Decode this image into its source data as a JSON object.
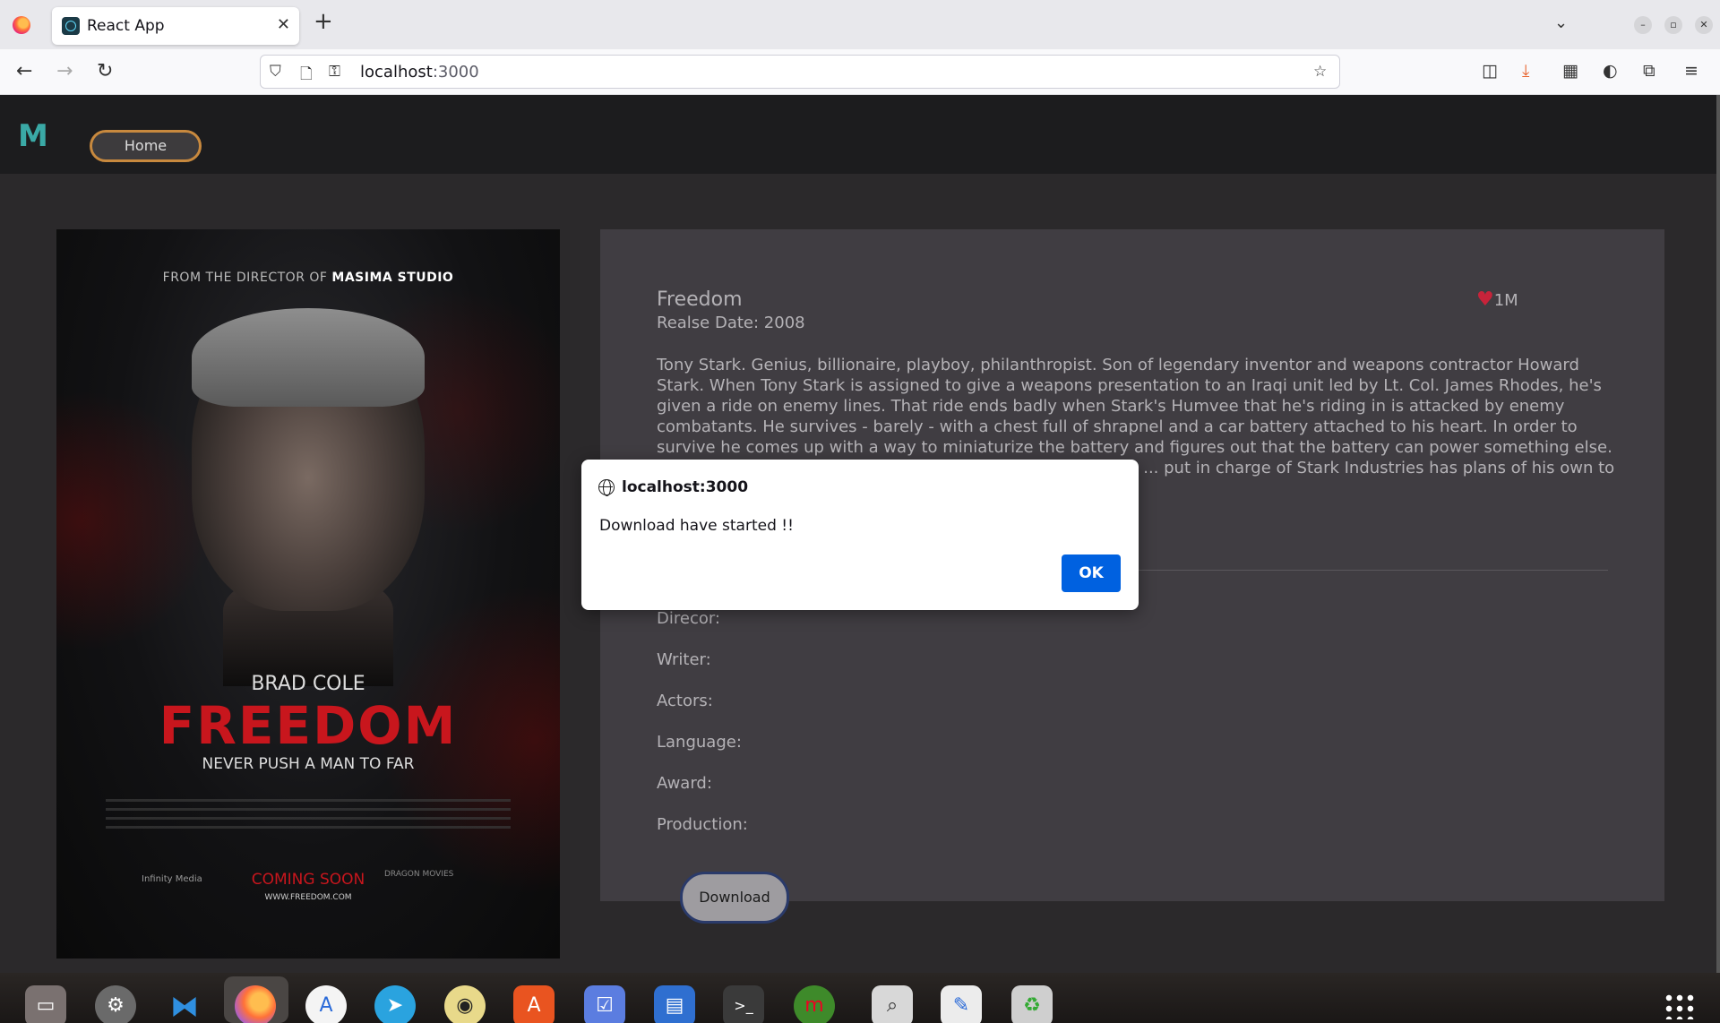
{
  "browser": {
    "tab_title": "React App",
    "tab_close": "✕",
    "new_tab": "+",
    "url_host": "localhost",
    "url_port": ":3000"
  },
  "site": {
    "logo": "M",
    "nav": {
      "home_label": "Home"
    }
  },
  "poster": {
    "from_prefix": "FROM THE DIRECTOR OF",
    "from_studio": "MASIMA STUDIO",
    "actor": "BRAD COLE",
    "title": "FREEDOM",
    "tagline": "NEVER PUSH A MAN TO FAR",
    "left_logo": "Infinity Media",
    "coming_soon": "COMING SOON",
    "url": "WWW.FREEDOM.COM",
    "right_logo": "DRAGON MOVIES"
  },
  "movie": {
    "title": "Freedom",
    "release": "Realse Date: 2008",
    "likes": "1M",
    "description": "Tony Stark. Genius, billionaire, playboy, philanthropist. Son of legendary inventor and weapons contractor Howard Stark. When Tony Stark is assigned to give a weapons presentation to an Iraqi unit led by Lt. Col. James Rhodes, he's given a ride on enemy lines. That ride ends badly when Stark's Humvee that he's riding in is attacked by enemy combatants. He survives - barely - with a chest full of shrapnel and a car battery attached to his heart. In order to survive he comes up with a way to miniaturize the battery and figures out that the battery can power something else. ... e from the cave in Iraq. Once back home, he then begins ... put in charge of Stark Industries has plans of his own to",
    "fields": {
      "director": "Direcor:",
      "writer": "Writer:",
      "actors": "Actors:",
      "language": "Language:",
      "award": "Award:",
      "production": "Production:"
    },
    "download_label": "Download"
  },
  "dialog": {
    "host": "localhost:3000",
    "message": "Download have started !!",
    "ok_label": "OK"
  },
  "colors": {
    "accent_ok": "#0061e0",
    "home_border": "#c8893e",
    "heart": "#c7233a",
    "poster_title": "#c8161d"
  },
  "icons": {
    "browser": [
      "back-icon",
      "forward-icon",
      "reload-icon",
      "shield-icon",
      "page-icon",
      "key-icon",
      "star-icon",
      "pocket-icon",
      "download-icon",
      "extension-icon",
      "menu-icon"
    ],
    "dock": [
      "files-icon",
      "settings-icon",
      "vscode-icon",
      "firefox-icon",
      "android-studio-icon",
      "telegram-icon",
      "rhythmbox-icon",
      "app-center-icon",
      "tasks-icon",
      "writer-icon",
      "terminal-icon",
      "meteor-icon",
      "image-viewer-icon",
      "text-editor-icon",
      "trash-icon",
      "apps-grid-icon"
    ]
  }
}
